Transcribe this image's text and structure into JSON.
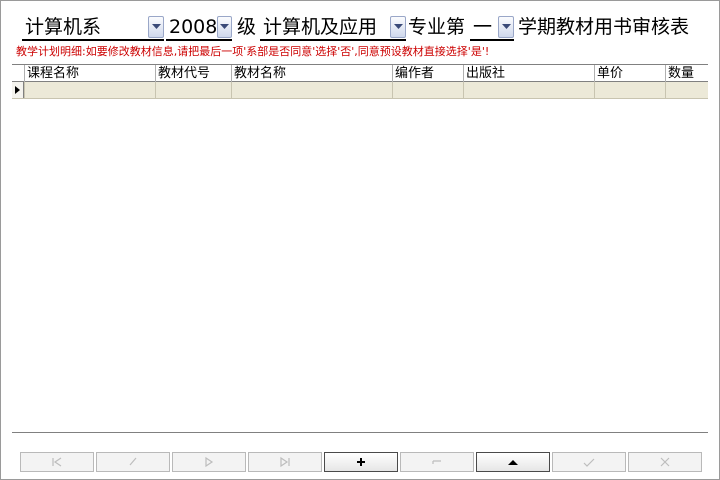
{
  "header": {
    "dept_value": "计算机系",
    "year_value": "2008",
    "level_label": "级",
    "major_value": "计算机及应用",
    "major_label": "专业第",
    "term_value": "一",
    "title_label": "学期教材用书审核表"
  },
  "note": "教学计划明细:如要修改教材信息,请把最后一项'系部是否同意'选择'否',同意预设教材直接选择'是'!",
  "grid": {
    "columns": [
      "课程名称",
      "教材代号",
      "教材名称",
      "编作者",
      "出版社",
      "单价",
      "数量"
    ]
  },
  "navigator": {
    "buttons": [
      {
        "name": "first-record",
        "icon": "first-icon",
        "enabled": false
      },
      {
        "name": "prior-record",
        "icon": "prior-icon",
        "enabled": false
      },
      {
        "name": "next-record",
        "icon": "next-icon",
        "enabled": false
      },
      {
        "name": "last-record",
        "icon": "last-icon",
        "enabled": false
      },
      {
        "name": "insert-record",
        "icon": "plus-icon",
        "enabled": true
      },
      {
        "name": "delete-record",
        "icon": "minus-icon",
        "enabled": false
      },
      {
        "name": "edit-record",
        "icon": "up-triangle-icon",
        "enabled": true
      },
      {
        "name": "post-record",
        "icon": "check-icon",
        "enabled": false
      },
      {
        "name": "cancel-record",
        "icon": "x-icon",
        "enabled": false
      }
    ]
  }
}
